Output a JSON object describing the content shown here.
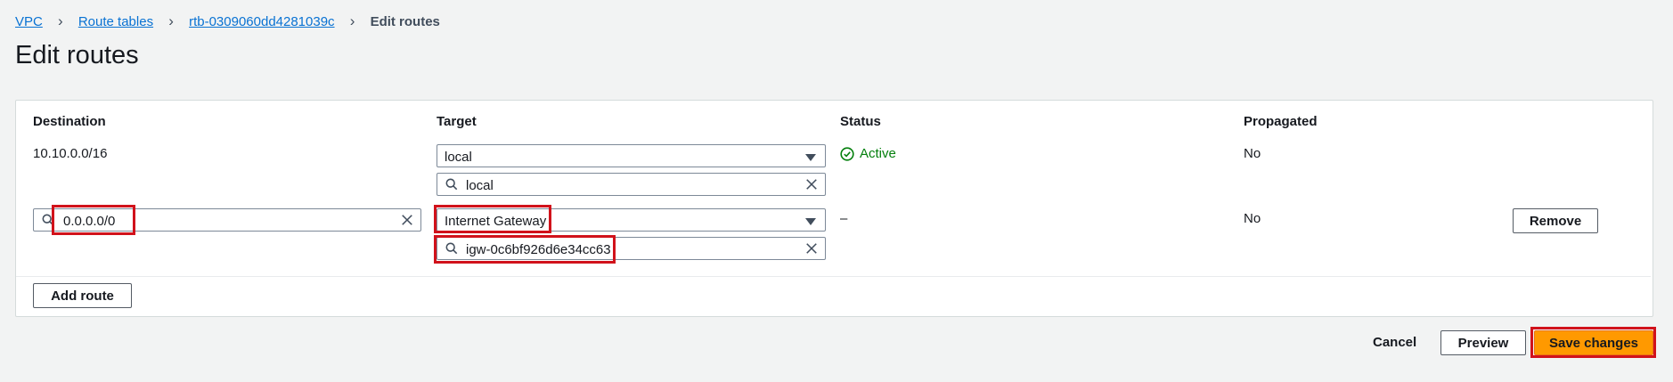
{
  "breadcrumb": {
    "items": [
      "VPC",
      "Route tables",
      "rtb-0309060dd4281039c"
    ],
    "current": "Edit routes"
  },
  "page": {
    "title": "Edit routes"
  },
  "table": {
    "headers": {
      "destination": "Destination",
      "target": "Target",
      "status": "Status",
      "propagated": "Propagated"
    },
    "rows": [
      {
        "destination": "10.10.0.0/16",
        "target_type": "local",
        "target_search": "local",
        "status": "Active",
        "propagated": "No"
      },
      {
        "destination": "0.0.0.0/0",
        "target_type": "Internet Gateway",
        "target_search": "igw-0c6bf926d6e34cc63",
        "status": "–",
        "propagated": "No",
        "remove_label": "Remove"
      }
    ]
  },
  "actions": {
    "add_route": "Add route",
    "cancel": "Cancel",
    "preview": "Preview",
    "save": "Save changes"
  },
  "colors": {
    "link": "#0972d3",
    "status_active": "#037f0c",
    "primary_button": "#ff9900",
    "highlight": "#d1121b"
  },
  "icons": {
    "breadcrumb_separator": "chevron-right-icon",
    "search": "search-icon",
    "clear": "close-icon",
    "dropdown": "caret-down-icon",
    "status": "check-circle-icon"
  }
}
